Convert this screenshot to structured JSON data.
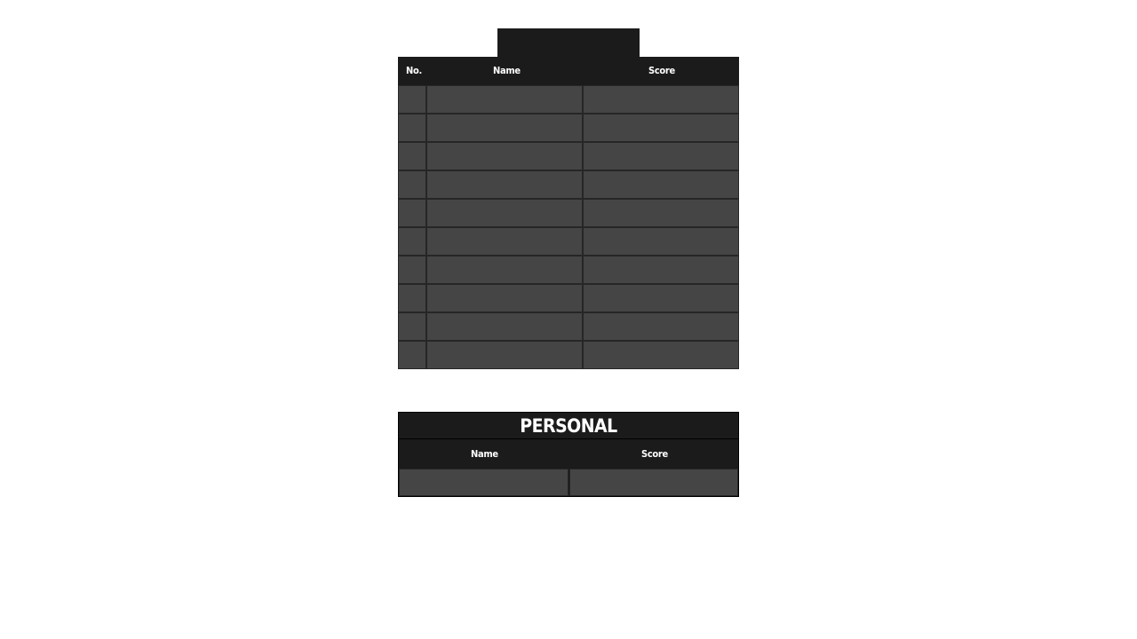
{
  "leaderboard": {
    "headers": {
      "no": "No.",
      "name": "Name",
      "score": "Score"
    },
    "row_count": 10
  },
  "personal": {
    "title": "PERSONAL",
    "headers": {
      "name": "Name",
      "score": "Score"
    }
  },
  "colors": {
    "header_bg": "#1b1b1b",
    "cell_bg": "#454545",
    "text": "#ffffff",
    "page_bg": "#ffffff"
  }
}
